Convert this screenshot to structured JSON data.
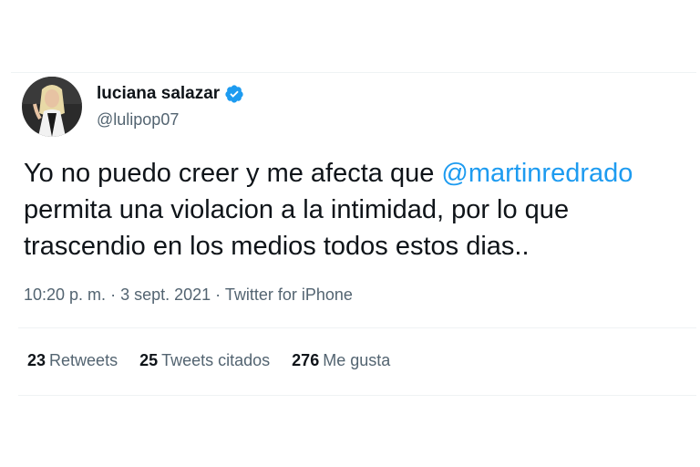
{
  "tweet": {
    "author": {
      "display_name": "luciana salazar",
      "handle": "@lulipop07",
      "verified": true
    },
    "text": {
      "before_mention": "Yo no puedo creer y me afecta que ",
      "mention": "@martinredrado",
      "after_mention": " permita una violacion a la intimidad, por lo que trascendio en los medios todos estos dias.."
    },
    "meta": {
      "time": "10:20 p. m.",
      "separator_1": " · ",
      "date": "3 sept. 2021",
      "separator_2": " · ",
      "source": "Twitter for iPhone"
    },
    "stats": {
      "retweets": {
        "count": "23",
        "label": "Retweets"
      },
      "quotes": {
        "count": "25",
        "label": "Tweets citados"
      },
      "likes": {
        "count": "276",
        "label": "Me gusta"
      }
    }
  },
  "colors": {
    "text": "#0f1419",
    "secondary": "#536471",
    "accent": "#1d9bf0",
    "divider": "#eff3f4"
  },
  "icons": {
    "verified": "verified-badge-icon"
  }
}
